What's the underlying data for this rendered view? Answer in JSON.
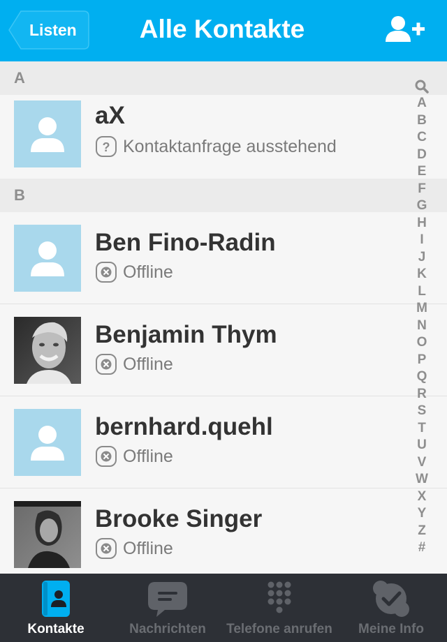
{
  "header": {
    "back_label": "Listen",
    "title": "Alle Kontakte",
    "add_contact_icon": "add-contact-icon"
  },
  "sections": [
    {
      "letter": "A",
      "contacts": [
        {
          "name": "aX",
          "status": "Kontaktanfrage ausstehend",
          "status_icon": "question-icon",
          "avatar": "default"
        }
      ]
    },
    {
      "letter": "B",
      "contacts": [
        {
          "name": "Ben Fino-Radin",
          "status": "Offline",
          "status_icon": "offline-icon",
          "avatar": "default"
        },
        {
          "name": "Benjamin Thym",
          "status": "Offline",
          "status_icon": "offline-icon",
          "avatar": "photo"
        },
        {
          "name": "bernhard.quehl",
          "status": "Offline",
          "status_icon": "offline-icon",
          "avatar": "default"
        },
        {
          "name": "Brooke Singer",
          "status": "Offline",
          "status_icon": "offline-icon",
          "avatar": "photo"
        }
      ]
    }
  ],
  "index": [
    "A",
    "B",
    "C",
    "D",
    "E",
    "F",
    "G",
    "H",
    "I",
    "J",
    "K",
    "L",
    "M",
    "N",
    "O",
    "P",
    "Q",
    "R",
    "S",
    "T",
    "U",
    "V",
    "W",
    "X",
    "Y",
    "Z",
    "#"
  ],
  "tabs": [
    {
      "label": "Kontakte",
      "icon": "contacts-icon",
      "active": true
    },
    {
      "label": "Nachrichten",
      "icon": "chat-icon",
      "active": false
    },
    {
      "label": "Telefone anrufen",
      "icon": "dialpad-icon",
      "active": false
    },
    {
      "label": "Meine Info",
      "icon": "skype-check-icon",
      "active": false
    }
  ],
  "colors": {
    "header_bg": "#00aff0",
    "tabbar_bg": "#2d3036",
    "avatar_bg": "#a9d8ec",
    "accent_active": "#00aff0"
  }
}
